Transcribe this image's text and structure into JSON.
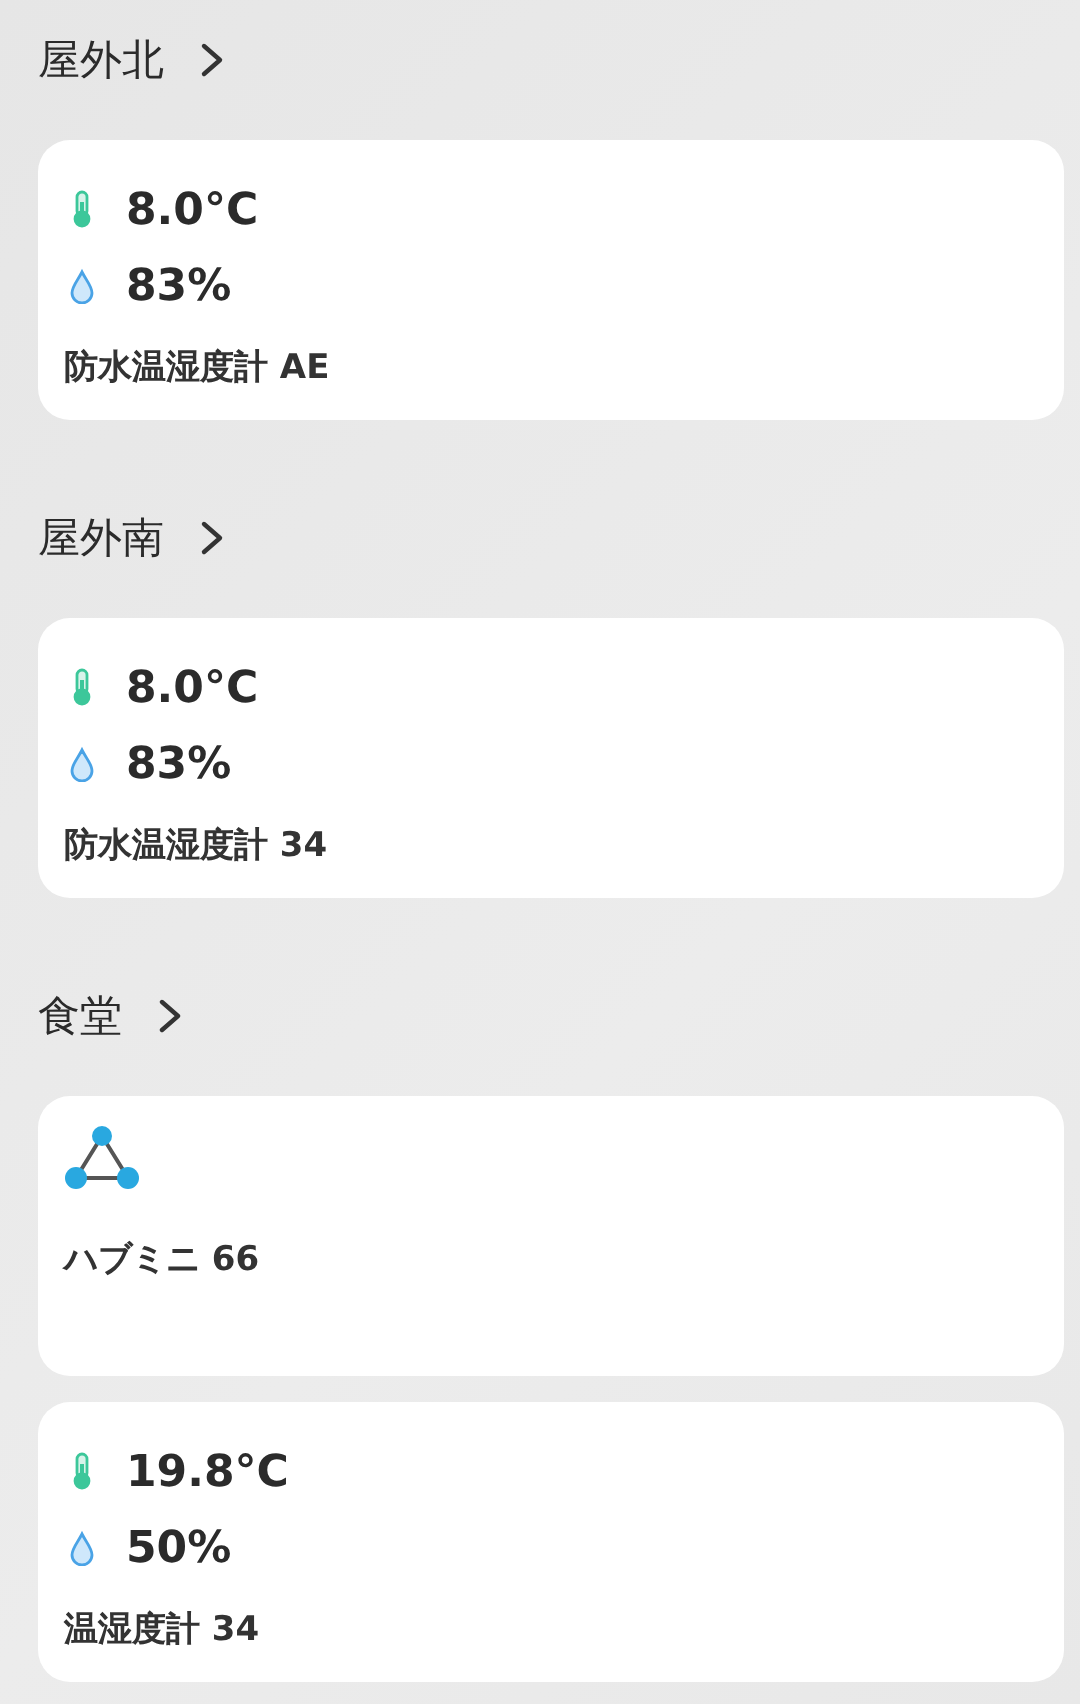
{
  "sections": [
    {
      "title": "屋外北",
      "devices": [
        {
          "kind": "sensor",
          "temperature": "8.0°C",
          "humidity": "83%",
          "name": "防水温湿度計 AE"
        }
      ]
    },
    {
      "title": "屋外南",
      "devices": [
        {
          "kind": "sensor",
          "temperature": "8.0°C",
          "humidity": "83%",
          "name": "防水温湿度計 34"
        }
      ]
    },
    {
      "title": "食堂",
      "devices": [
        {
          "kind": "hub",
          "name": "ハブミニ 66"
        },
        {
          "kind": "sensor",
          "temperature": "19.8°C",
          "humidity": "50%",
          "name": "温湿度計 34"
        }
      ]
    }
  ]
}
